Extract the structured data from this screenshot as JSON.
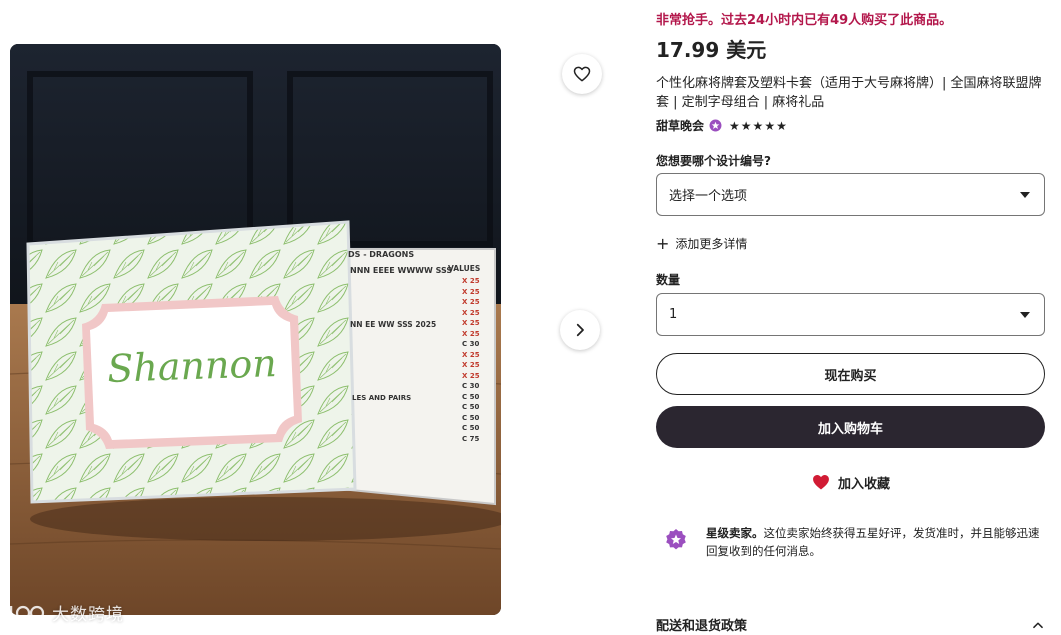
{
  "gallery": {
    "photo_name_text": "Shannon",
    "card_heading": "DS - DRAGONS",
    "card_values_header": "VALUES",
    "card_sections": [
      "NNN EEEE WWWW SSS",
      "NN EE WW SSS 2025",
      "LES AND PAIRS"
    ],
    "card_points": [
      "X 25",
      "X 25",
      "X 25",
      "X 25",
      "X 25",
      "X 25",
      "C 30",
      "X 25",
      "X 25",
      "X 25",
      "C 30",
      "C 50",
      "C 50",
      "C 50",
      "C 50",
      "C 75"
    ],
    "watermark": "大数跨境"
  },
  "listing": {
    "urgency": "非常抢手。过去24小时内已有49人购买了此商品。",
    "price": "17.99 美元",
    "title": "个性化麻将牌套及塑料卡套（适用于大号麻将牌）| 全国麻将联盟牌套 | 定制字母组合 | 麻将礼品",
    "shop_name": "甜草晚会",
    "rating": 5,
    "stars": [
      "★",
      "★",
      "★",
      "★",
      "★"
    ]
  },
  "options": {
    "design_label": "您想要哪个设计编号?",
    "design_value": "选择一个选项",
    "more_details": "添加更多详情",
    "quantity_label": "数量",
    "quantity_value": "1"
  },
  "actions": {
    "buy_now": "现在购买",
    "add_to_cart": "加入购物车",
    "add_to_favorites": "加入收藏"
  },
  "star_seller": {
    "title": "星级卖家。",
    "text": "这位卖家始终获得五星好评，发货准时，并且能够迅速回复收到的任何消息。"
  },
  "shipping": {
    "label": "配送和退货政策"
  },
  "colors": {
    "urgency": "#b3174b",
    "primary_button": "#2b2630",
    "heart": "#d11b34",
    "star_badge": "#9b4fbf"
  },
  "icons": [
    "heart-outline-icon",
    "chevron-right-icon",
    "caret-down-icon",
    "plus-icon",
    "heart-filled-icon",
    "star-seller-badge-icon",
    "chevron-up-icon",
    "watermark-logo-icon"
  ]
}
